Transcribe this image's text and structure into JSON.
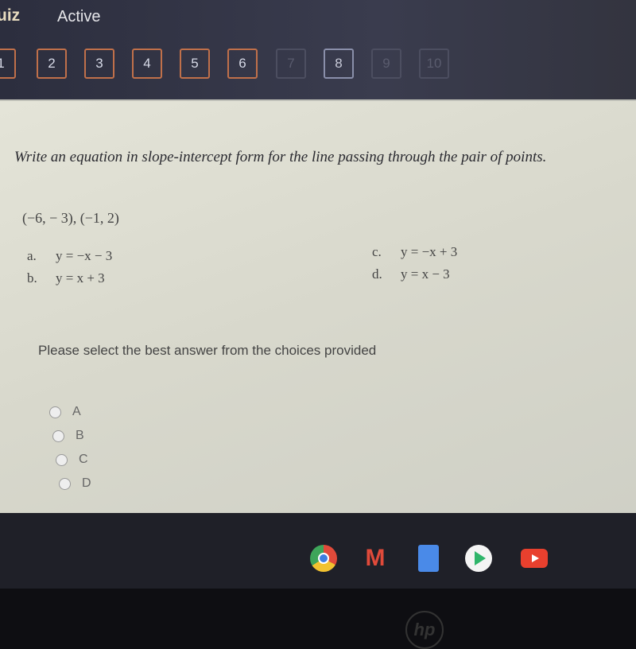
{
  "header": {
    "title": "uiz",
    "status": "Active"
  },
  "questions": [
    {
      "label": "1",
      "state": "answered"
    },
    {
      "label": "2",
      "state": "answered"
    },
    {
      "label": "3",
      "state": "answered"
    },
    {
      "label": "4",
      "state": "answered"
    },
    {
      "label": "5",
      "state": "answered"
    },
    {
      "label": "6",
      "state": "answered"
    },
    {
      "label": "7",
      "state": "unanswered"
    },
    {
      "label": "8",
      "state": "current"
    },
    {
      "label": "9",
      "state": "unanswered"
    },
    {
      "label": "10",
      "state": "unanswered"
    }
  ],
  "question": {
    "text": "Write an equation in slope-intercept form for the line passing through the pair of points.",
    "points": "(−6, − 3), (−1, 2)",
    "choices": [
      {
        "letter": "a.",
        "eq": "y = −x − 3"
      },
      {
        "letter": "b.",
        "eq": "y = x + 3"
      },
      {
        "letter": "c.",
        "eq": "y = −x + 3"
      },
      {
        "letter": "d.",
        "eq": "y = x − 3"
      }
    ],
    "prompt": "Please select the best answer from the choices provided",
    "options": [
      "A",
      "B",
      "C",
      "D"
    ]
  },
  "taskbar": {
    "apps": [
      "chrome-icon",
      "gmail-icon",
      "docs-icon",
      "play-store-icon",
      "youtube-icon"
    ]
  },
  "colors": {
    "answered_border": "#c0704a",
    "panel_bg": "#dcdcd0",
    "header_bg": "#2e3040"
  },
  "bezel_logo": "hp"
}
